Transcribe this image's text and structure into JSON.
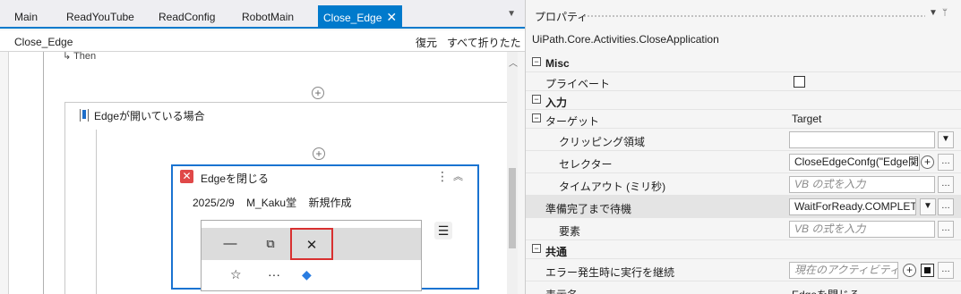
{
  "tabs": [
    {
      "label": "Main"
    },
    {
      "label": "ReadYouTube"
    },
    {
      "label": "ReadConfig"
    },
    {
      "label": "RobotMain"
    },
    {
      "label": "Close_Edge",
      "active": true
    }
  ],
  "breadcrumb": {
    "label": "Close_Edge",
    "restore": "復元",
    "collapse_all": "すべて折りたたむ"
  },
  "canvas": {
    "then_label": "Then",
    "sequence_label": "Edgeが開いている場合",
    "activity": {
      "title": "Edgeを閉じる",
      "date": "2025/2/9",
      "author": "M_Kaku堂",
      "status": "新規作成",
      "screenshot_buttons": {
        "minimize": "—",
        "restore": "⧉",
        "close": "✕"
      }
    }
  },
  "properties": {
    "title": "プロパティ",
    "class_name": "UiPath.Core.Activities.CloseApplication",
    "categories": {
      "misc": "Misc",
      "input": "入力",
      "common": "共通"
    },
    "rows": {
      "private": "プライベート",
      "target": "ターゲット",
      "target_value": "Target",
      "clipping": "クリッピング領域",
      "selector": "セレクター",
      "selector_value": "CloseEdgeConfg(\"Edge関",
      "timeout": "タイムアウト (ミリ秒)",
      "timeout_placeholder": "VB の式を入力",
      "wait_ready": "準備完了まで待機",
      "wait_ready_value": "WaitForReady.COMPLETE",
      "element": "要素",
      "element_placeholder": "VB の式を入力",
      "continue_on_error": "エラー発生時に実行を継続",
      "continue_on_error_placeholder": "現在のアクティビティが失",
      "display_name": "表示名",
      "display_name_value": "Edgeを閉じる"
    }
  },
  "colors": {
    "accent": "#007acc",
    "activity_border": "#1a73d1",
    "close_highlight": "#d83030"
  }
}
